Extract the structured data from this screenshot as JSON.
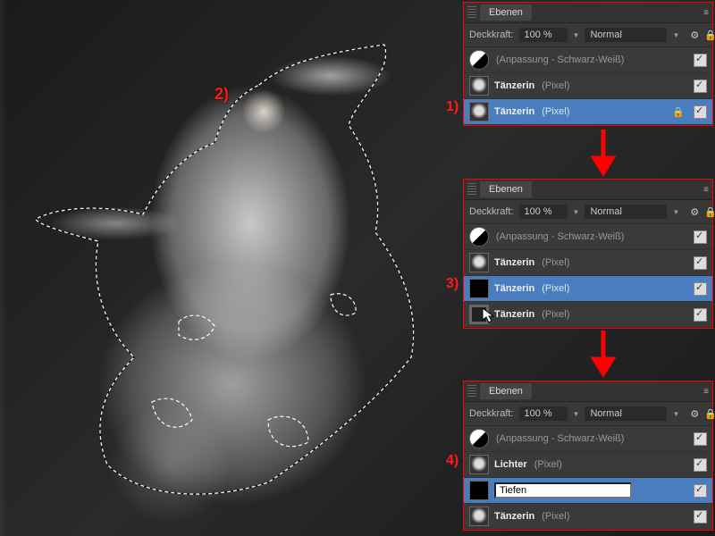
{
  "annotations": {
    "canvas": "2)",
    "step1": "1)",
    "step2": "3)",
    "step3": "4)"
  },
  "panel_common": {
    "tab": "Ebenen",
    "opacity_label": "Deckkraft:",
    "opacity_value": "100 %",
    "blend_mode": "Normal",
    "gear_icon": "⚙",
    "lock_icon": "🔒",
    "menu_icon": "≡"
  },
  "layer_labels": {
    "adjustment": "(Anpassung - Schwarz-Weiß)",
    "dancer": "Tänzerin",
    "lights": "Lichter",
    "depths_input": "Tiefen",
    "type_pixel": "(Pixel)"
  }
}
